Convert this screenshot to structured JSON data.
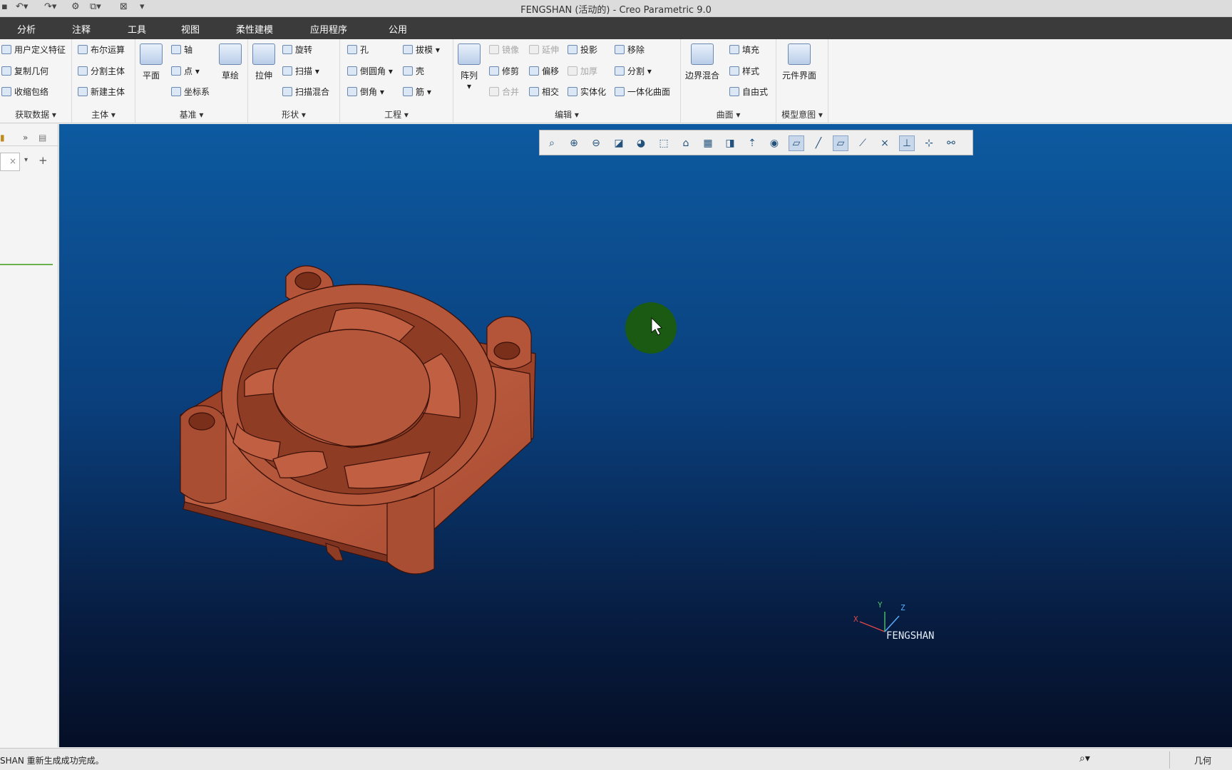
{
  "window": {
    "title": "FENGSHAN (活动的) - Creo Parametric 9.0"
  },
  "menu": [
    "分析",
    "注释",
    "工具",
    "视图",
    "柔性建模",
    "应用程序",
    "公用"
  ],
  "ribbon": {
    "get_data": {
      "label": "获取数据",
      "items": [
        "用户定义特征",
        "复制几何",
        "收缩包络"
      ]
    },
    "body": {
      "label": "主体",
      "items": [
        "布尔运算",
        "分割主体",
        "新建主体"
      ]
    },
    "datum": {
      "label": "基准",
      "plane": "平面",
      "axis": "轴",
      "point": "点",
      "csys": "坐标系",
      "sketch": "草绘"
    },
    "shape": {
      "label": "形状",
      "extrude": "拉伸",
      "revolve": "旋转",
      "sweep": "扫描",
      "swept_blend": "扫描混合"
    },
    "engineering": {
      "label": "工程",
      "hole": "孔",
      "round": "倒圆角",
      "chamfer": "倒角",
      "draft": "拔模",
      "shell": "壳",
      "rib": "筋"
    },
    "editing": {
      "label": "编辑",
      "pattern": "阵列",
      "mirror": "镜像",
      "extend": "延伸",
      "project": "投影",
      "remove": "移除",
      "trim": "修剪",
      "offset": "偏移",
      "thicken": "加厚",
      "split": "分割",
      "merge": "合并",
      "intersect": "相交",
      "solidify": "实体化",
      "unify": "一体化曲面"
    },
    "surfaces": {
      "label": "曲面",
      "boundary": "边界混合",
      "fill": "填充",
      "style": "样式",
      "freestyle": "自由式"
    },
    "model_intent": {
      "label": "模型意图",
      "component_interface": "元件界面"
    }
  },
  "viewport": {
    "model_name": "FENGSHAN",
    "axes": {
      "x": "X",
      "y": "Y",
      "z": "Z"
    }
  },
  "status": {
    "message": "SHAN 重新生成成功完成。",
    "filter": "几何"
  },
  "colors": {
    "model": "#b5573a",
    "background_top": "#0d5aa0",
    "background_bottom": "#050f26",
    "cursor_marker": "#1a5a12"
  }
}
